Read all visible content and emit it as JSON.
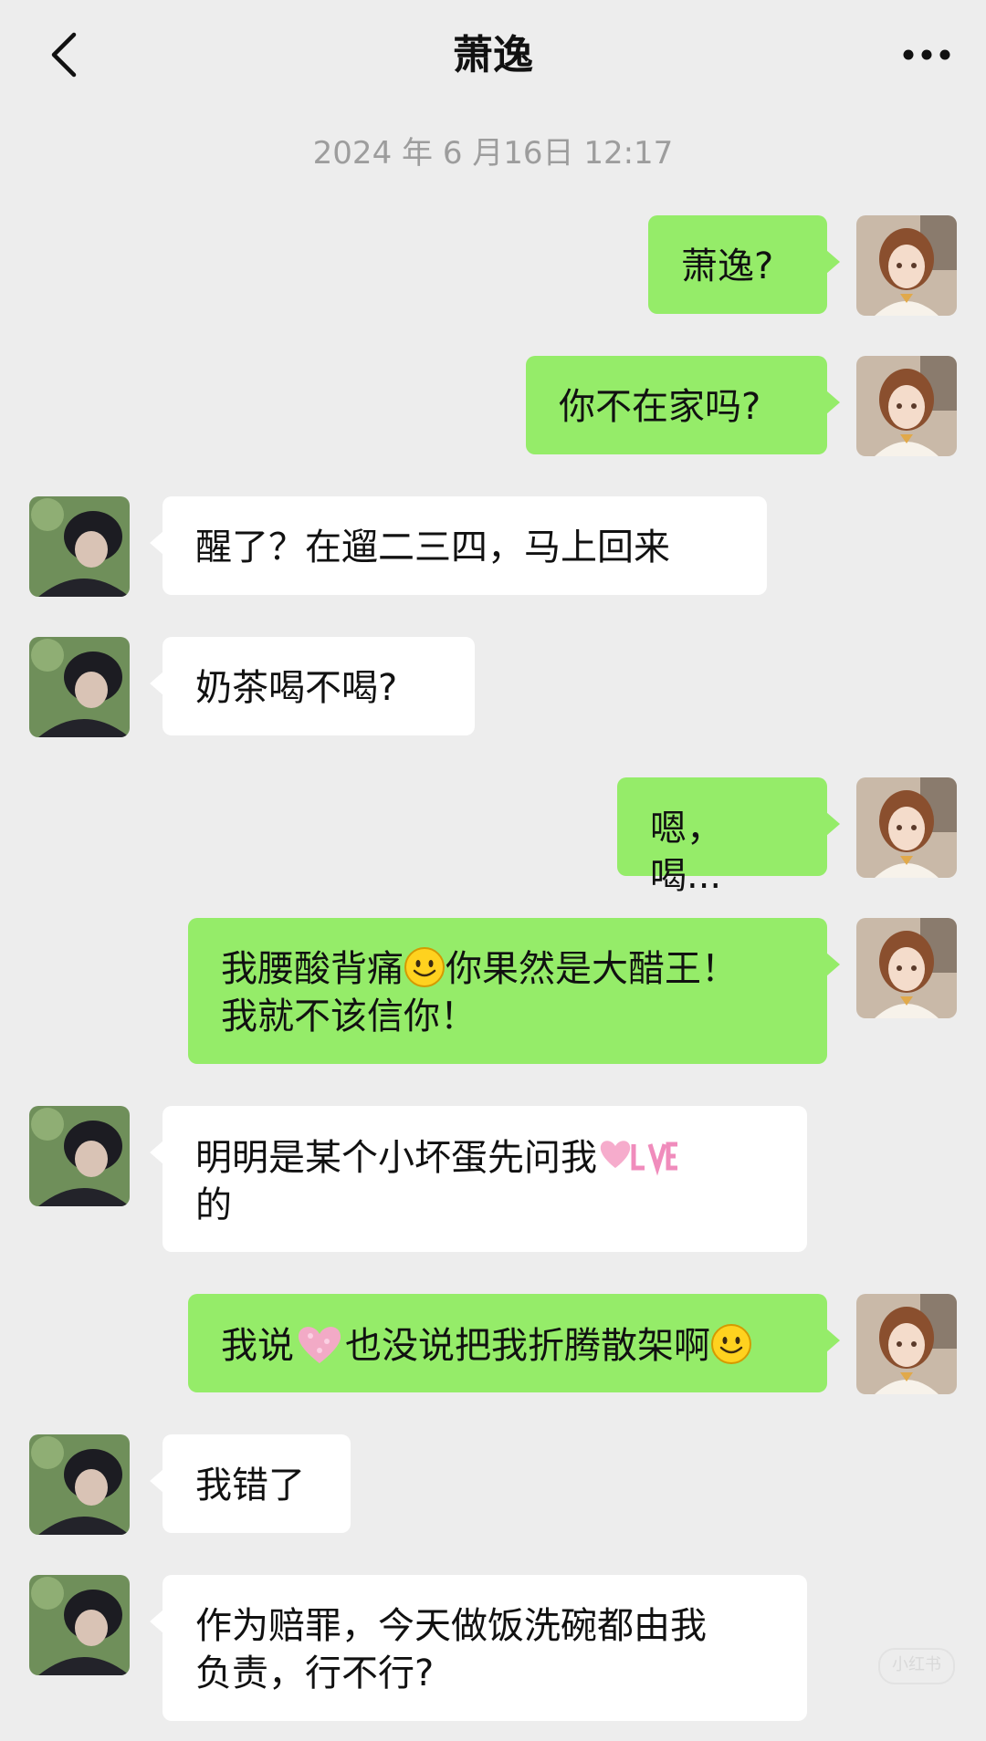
{
  "header": {
    "title": "萧逸",
    "back_icon": "chevron-left-icon",
    "more_icon": "more-horizontal-icon"
  },
  "timestamp": "2024 年 6 月16日 12:17",
  "colors": {
    "background": "#ededed",
    "self_bubble": "#95ec69",
    "other_bubble": "#ffffff",
    "timestamp": "#9d9d9d"
  },
  "messages": [
    {
      "sender": "self",
      "text": "萧逸?"
    },
    {
      "sender": "self",
      "text": "你不在家吗?"
    },
    {
      "sender": "other",
      "text": "醒了？在遛二三四，马上回来"
    },
    {
      "sender": "other",
      "text": "奶茶喝不喝?"
    },
    {
      "sender": "self",
      "text": "嗯，喝..."
    },
    {
      "sender": "self",
      "parts": [
        "我腰酸背痛",
        "你果然是大醋王！",
        "我就不该信你！"
      ],
      "emoji": "smile-emoji"
    },
    {
      "sender": "other",
      "parts": [
        "明明是某个小坏蛋先问我",
        "的"
      ],
      "sticker": "love-sticker"
    },
    {
      "sender": "self",
      "parts": [
        "我说",
        "也没说把我折腾散架啊"
      ],
      "sticker": "heart-sticker",
      "emoji": "smile-emoji"
    },
    {
      "sender": "other",
      "text": "我错了"
    },
    {
      "sender": "other",
      "parts": [
        "作为赔罪，今天做饭洗碗都由我",
        "负责，行不行?"
      ]
    }
  ],
  "watermark": "小红书"
}
